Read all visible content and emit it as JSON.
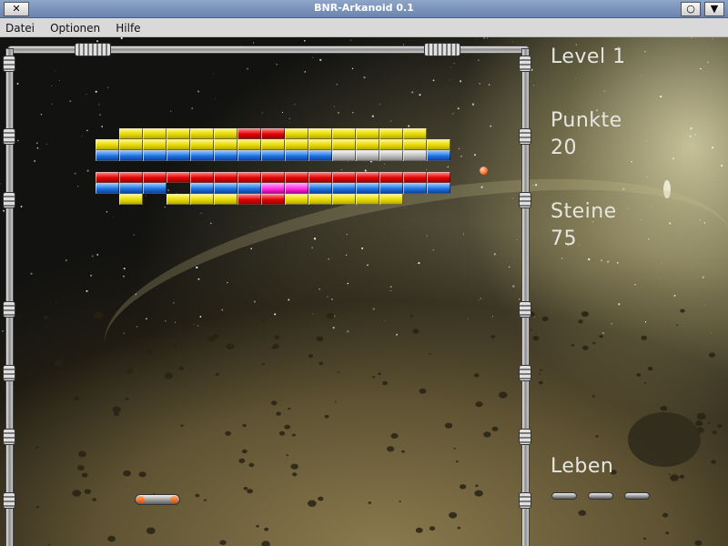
{
  "window": {
    "title": "BNR-Arkanoid 0.1",
    "close_glyph": "✕",
    "maximize_glyph": "○",
    "menu_glyph": "▼"
  },
  "menu": {
    "items": [
      "Datei",
      "Optionen",
      "Hilfe"
    ]
  },
  "hud": {
    "level_label": "Level 1",
    "points_label": "Punkte",
    "points_value": "20",
    "stones_label": "Steine",
    "stones_value": "75",
    "lives_label": "Leben",
    "lives_count": 3
  },
  "colors": {
    "yellow": "#e6d800",
    "red": "#e00000",
    "blue": "#1f6fe0",
    "gray": "#bdbdbd",
    "magenta": "#ff2ddc"
  },
  "bricks": {
    "rows": [
      "..YYYYYRRYYYYYY.",
      ".YYYYYYYYYYYYYYY",
      ".BBBBBBBBBBGGGGB",
      "................",
      ".RRRRRRRRRRRRRRR",
      ".BBB.BBBMMBBBBBB",
      "..Y.YYYRRYYYYY.."
    ]
  }
}
